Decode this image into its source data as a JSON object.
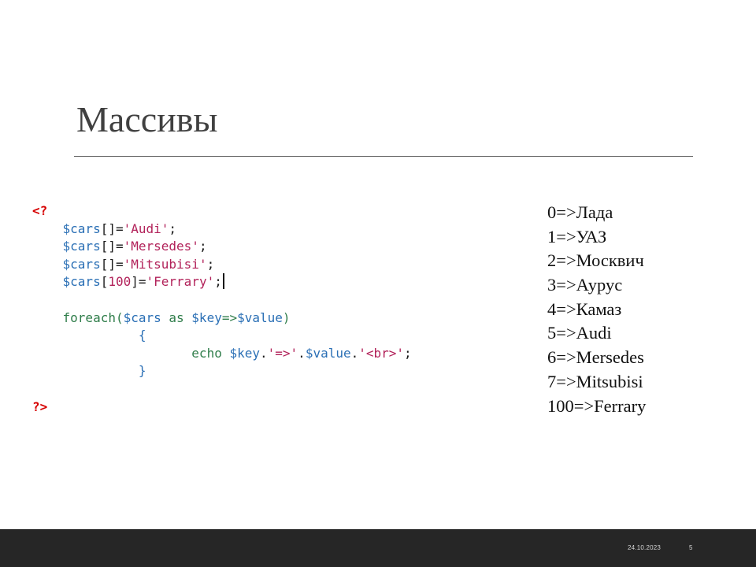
{
  "slide": {
    "title": "Массивы",
    "date": "24.10.2023",
    "page_number": "5"
  },
  "code": {
    "open_tag": "<?",
    "close_tag": "?>",
    "lines": {
      "l1": {
        "var": "$cars",
        "br": "[]=",
        "str": "'Audi'",
        "end": ";"
      },
      "l2": {
        "var": "$cars",
        "br": "[]=",
        "str": "'Mersedes'",
        "end": ";"
      },
      "l3": {
        "var": "$cars",
        "br": "[]=",
        "str": "'Mitsubisi'",
        "end": ";"
      },
      "l4": {
        "var": "$cars",
        "br_open": "[",
        "num": "100",
        "br_close": "]=",
        "str": "'Ferrary'",
        "end": ";"
      },
      "foreach": {
        "kw": "foreach(",
        "var1": "$cars",
        "as": " as ",
        "var2": "$key",
        "arrow": "=>",
        "var3": "$value",
        "close": ")"
      },
      "brace_open": "{",
      "echo": {
        "kw": "echo ",
        "v1": "$key",
        "dot1": ".",
        "s1": "'=>'",
        "dot2": ".",
        "v2": "$value",
        "dot3": ".",
        "s2": "'<br>'",
        "end": ";"
      },
      "brace_close": "}"
    }
  },
  "output": {
    "rows": [
      "0=>Лада",
      "1=>УАЗ",
      "2=>Москвич",
      "3=>Аурус",
      "4=>Камаз",
      "5=>Audi",
      "6=>Mersedes",
      "7=>Mitsubisi",
      "100=>Ferrary"
    ]
  },
  "colors": {
    "footer_bg": "#262626",
    "title": "#404040",
    "php_tag": "#d60000",
    "variable": "#2a6fb5",
    "string": "#b2225a",
    "keyword": "#2f7d4a"
  }
}
